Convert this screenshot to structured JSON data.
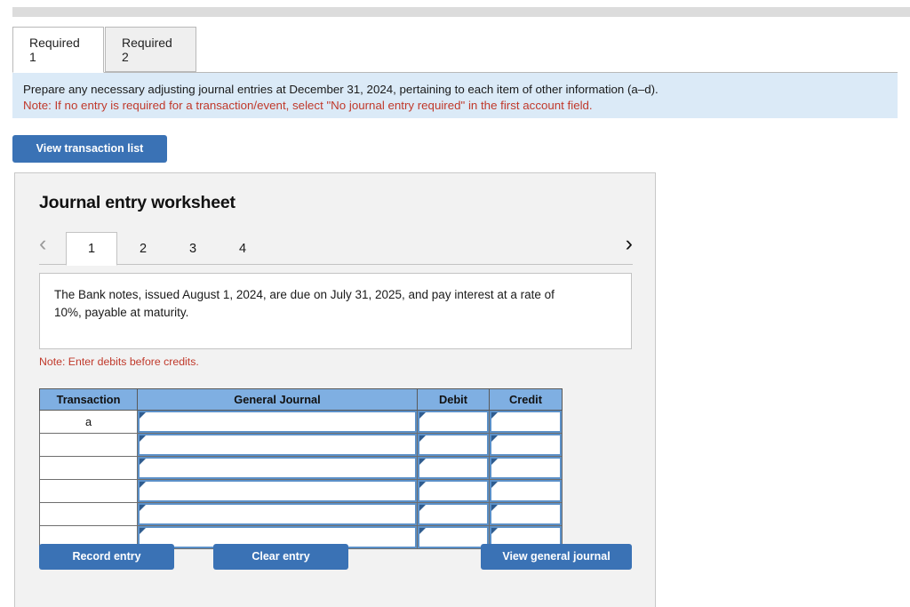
{
  "tabs": [
    {
      "label": "Required 1",
      "active": true
    },
    {
      "label": "Required 2",
      "active": false
    }
  ],
  "instructions": {
    "line1": "Prepare any necessary adjusting journal entries at December 31, 2024, pertaining to each item of other information (a–d).",
    "note": "Note: If no entry is required for a transaction/event, select \"No journal entry required\" in the first account field.",
    "note_color": "#c0392b",
    "background_color": "#dbeaf7"
  },
  "toolbar": {
    "view_transaction_list_label": "View transaction list"
  },
  "worksheet": {
    "title": "Journal entry worksheet",
    "pager": {
      "prev_icon": "chevron-left-icon",
      "next_icon": "chevron-right-icon",
      "pages": [
        "1",
        "2",
        "3",
        "4"
      ],
      "active_page": "1"
    },
    "description": "The Bank notes, issued August 1, 2024, are due on July 31, 2025, and pay interest at a rate of 10%, payable at maturity.",
    "debits_note": "Note: Enter debits before credits.",
    "table": {
      "headers": [
        "Transaction",
        "General Journal",
        "Debit",
        "Credit"
      ],
      "header_color": "#7fafe2",
      "rows": [
        {
          "transaction": "a",
          "general_journal": "",
          "debit": "",
          "credit": ""
        },
        {
          "transaction": "",
          "general_journal": "",
          "debit": "",
          "credit": ""
        },
        {
          "transaction": "",
          "general_journal": "",
          "debit": "",
          "credit": ""
        },
        {
          "transaction": "",
          "general_journal": "",
          "debit": "",
          "credit": ""
        },
        {
          "transaction": "",
          "general_journal": "",
          "debit": "",
          "credit": ""
        },
        {
          "transaction": "",
          "general_journal": "",
          "debit": "",
          "credit": ""
        }
      ]
    },
    "actions": {
      "record_entry_label": "Record entry",
      "clear_entry_label": "Clear entry",
      "view_general_journal_label": "View general journal",
      "button_color": "#3a72b5"
    }
  }
}
